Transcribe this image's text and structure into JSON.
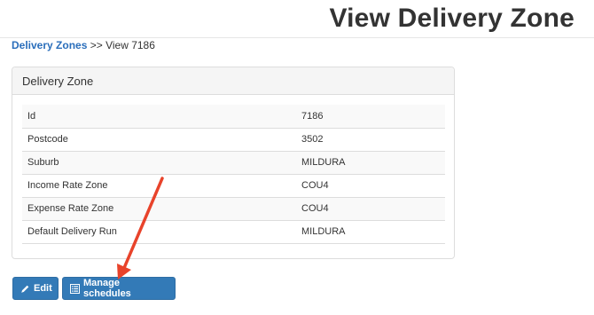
{
  "header": {
    "title": "View Delivery Zone"
  },
  "breadcrumb": {
    "link_label": "Delivery Zones",
    "separator": ">>",
    "current": "View 7186"
  },
  "panel": {
    "heading": "Delivery Zone",
    "rows": [
      {
        "label": "Id",
        "value": "7186"
      },
      {
        "label": "Postcode",
        "value": "3502"
      },
      {
        "label": "Suburb",
        "value": "MILDURA"
      },
      {
        "label": "Income Rate Zone",
        "value": "COU4"
      },
      {
        "label": "Expense Rate Zone",
        "value": "COU4"
      },
      {
        "label": "Default Delivery Run",
        "value": "MILDURA"
      }
    ]
  },
  "actions": {
    "edit_label": "Edit",
    "manage_label": "Manage schedules"
  },
  "colors": {
    "primary_button": "#337ab7",
    "link": "#2a6ebb",
    "annotation_arrow": "#e8432b"
  },
  "icons": {
    "edit": "pencil-icon",
    "manage": "list-icon"
  }
}
